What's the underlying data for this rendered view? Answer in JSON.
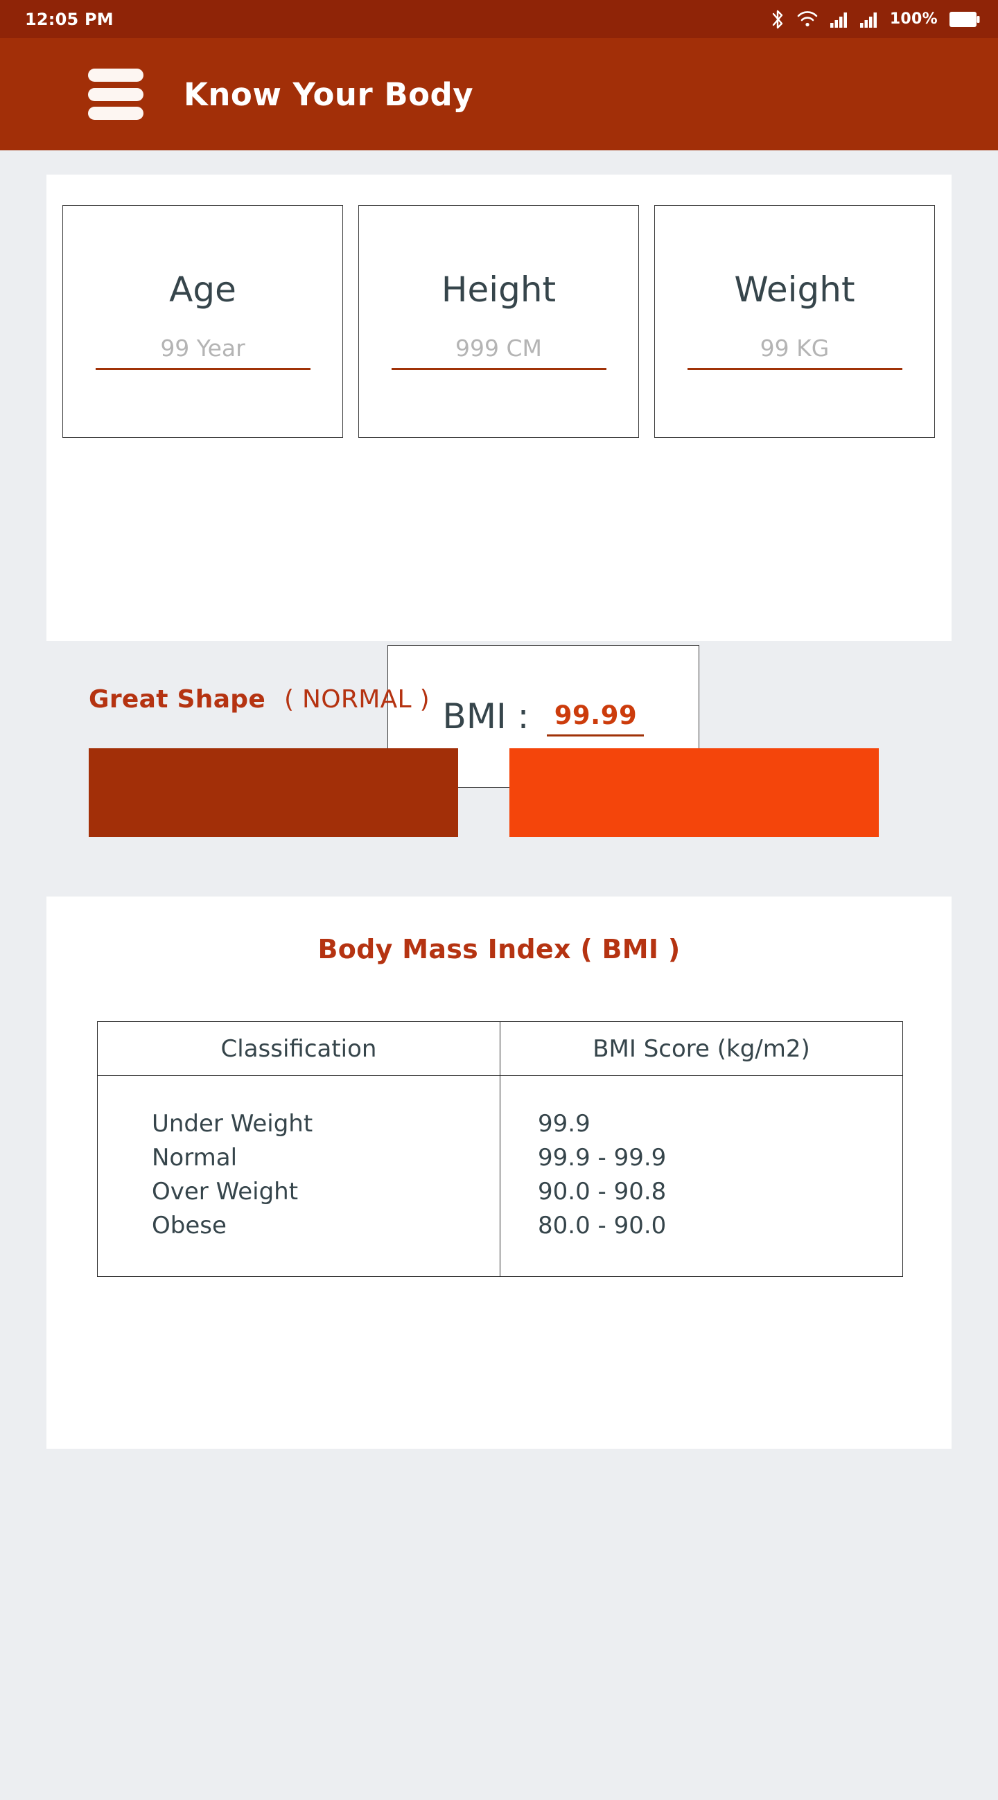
{
  "statusbar": {
    "time": "12:05 PM",
    "battery_percent": "100%",
    "icons": [
      "bluetooth-icon",
      "wifi-icon",
      "signal-icon-1",
      "signal-icon-2",
      "battery-icon"
    ]
  },
  "appbar": {
    "menu_icon": "hamburger-menu-icon",
    "title": "Know Your Body"
  },
  "inputs": {
    "age": {
      "label": "Age",
      "placeholder": "99 Year",
      "value": ""
    },
    "height": {
      "label": "Height",
      "placeholder": "999 CM",
      "value": ""
    },
    "weight": {
      "label": "Weight",
      "placeholder": "99 KG",
      "value": ""
    }
  },
  "bmi_result": {
    "label": "BMI :",
    "value": "99.99"
  },
  "shape_status": {
    "text": "Great Shape",
    "category": "( NORMAL )"
  },
  "bars": {
    "left_color": "#a22f08",
    "right_color": "#f4450b"
  },
  "bmi_table": {
    "title": "Body Mass Index ( BMI )",
    "headers": [
      "Classification",
      "BMI Score (kg/m2)"
    ],
    "rows": [
      {
        "classification": "Under Weight",
        "score": "99.9"
      },
      {
        "classification": "Normal",
        "score": "99.9 - 99.9"
      },
      {
        "classification": "Over Weight",
        "score": "90.0 - 90.8"
      },
      {
        "classification": "Obese",
        "score": "80.0 - 90.0"
      }
    ]
  },
  "colors": {
    "brand_primary": "#a22f08",
    "brand_dark": "#8f2407",
    "accent_orange": "#f4450b",
    "heading_red": "#b53311",
    "underline": "#a03208",
    "page_bg": "#eceef1",
    "text_dark": "#36454b"
  }
}
